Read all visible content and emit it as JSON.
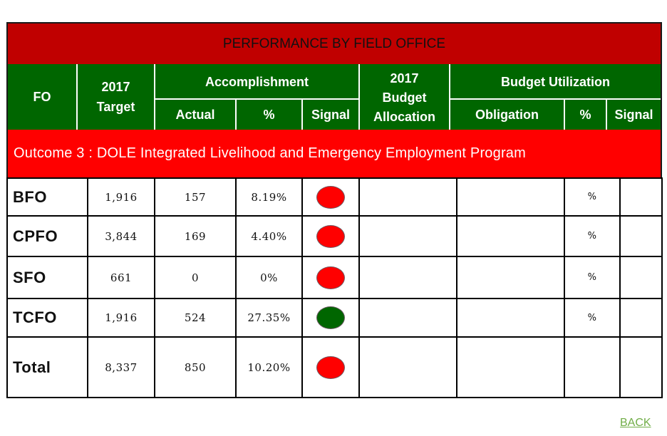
{
  "title": "PERFORMANCE BY FIELD OFFICE",
  "headers": {
    "fo": "FO",
    "target_line1": "2017",
    "target_line2": "Target",
    "accomplishment": "Accomplishment",
    "actual": "Actual",
    "percent": "%",
    "signal": "Signal",
    "allocation_line1": "2017",
    "allocation_line2": "Budget",
    "allocation_line3": "Allocation",
    "budget_utilization": "Budget Utilization",
    "obligation": "Obligation",
    "bu_percent": "%",
    "bu_signal": "Signal"
  },
  "outcome": "Outcome 3 : DOLE Integrated Livelihood and Emergency Employment Program",
  "colors": {
    "title_bg": "#c00000",
    "header_bg": "#006600",
    "outcome_bg": "#ff0000",
    "signal_red": "#ff0000",
    "signal_green": "#006600",
    "back_link": "#70ad47"
  },
  "rows": [
    {
      "fo": "BFO",
      "target": "1,916",
      "actual": "157",
      "percent": "8.19%",
      "signal": "red",
      "allocation": "",
      "obligation": "",
      "bu_percent": "%",
      "bu_signal": ""
    },
    {
      "fo": "CPFO",
      "target": "3,844",
      "actual": "169",
      "percent": "4.40%",
      "signal": "red",
      "allocation": "",
      "obligation": "",
      "bu_percent": "%",
      "bu_signal": ""
    },
    {
      "fo": "SFO",
      "target": "661",
      "actual": "0",
      "percent": "0%",
      "signal": "red",
      "allocation": "",
      "obligation": "",
      "bu_percent": "%",
      "bu_signal": ""
    },
    {
      "fo": "TCFO",
      "target": "1,916",
      "actual": "524",
      "percent": "27.35%",
      "signal": "green",
      "allocation": "",
      "obligation": "",
      "bu_percent": "%",
      "bu_signal": ""
    },
    {
      "fo": "Total",
      "target": "8,337",
      "actual": "850",
      "percent": "10.20%",
      "signal": "red",
      "allocation": "",
      "obligation": "",
      "bu_percent": "",
      "bu_signal": ""
    }
  ],
  "back_link": "BACK"
}
